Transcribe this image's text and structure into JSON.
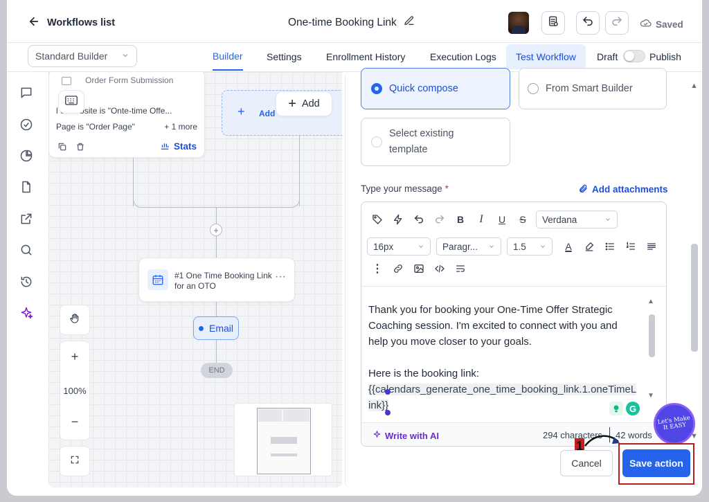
{
  "header": {
    "back_label": "Workflows list",
    "workflow_title": "One-time Booking Link",
    "saved_label": "Saved"
  },
  "subbar": {
    "builder_select": "Standard Builder",
    "tabs": [
      "Builder",
      "Settings",
      "Enrollment History",
      "Execution Logs",
      "Test Workflow"
    ],
    "active_tab": "Builder",
    "draft_label": "Draft",
    "publish_label": "Publish"
  },
  "canvas": {
    "trigger_title": "Order Form Submission",
    "trigger_filter_1": "l   el/website is \"Onte-time Offe...",
    "trigger_filter_2": "Page is \"Order Page\"",
    "trigger_more": "+ 1 more",
    "stats_label": "Stats",
    "add_label": "Add",
    "add_ghost_label": "Add",
    "action_title": "#1 One Time Booking Link for an OTO",
    "email_label": "Email",
    "end_label": "END",
    "zoom_level": "100%"
  },
  "panel": {
    "options": [
      "Quick compose",
      "From Smart Builder",
      "Select existing template"
    ],
    "selected_option": "Quick compose",
    "message_label": "Type your message",
    "required_mark": "*",
    "attachments_label": "Add attachments",
    "font_family": "Verdana",
    "font_size": "16px",
    "paragraph_style": "Paragr...",
    "line_height": "1.5",
    "message_lines": [
      "Thank you for booking your One-Time Offer Strategic",
      "Coaching session. I'm excited to connect with you and",
      "help you move closer to your goals.",
      "",
      "Here is the booking link:"
    ],
    "booking_variable_1": "{{calendars_generate_one_time_booking_link.1.oneTimeL",
    "booking_variable_2": "ink}}",
    "write_ai_label": "Write with AI",
    "char_count": "294 characters",
    "word_count": "42 words",
    "cancel_label": "Cancel",
    "save_label": "Save action"
  },
  "overlay": {
    "step_number": "1",
    "badge_text": "Let's Make It EASY"
  },
  "colors": {
    "accent": "#2563eb",
    "highlight_border": "#b91c1c",
    "selected_option_bg": "#eef4ff"
  }
}
